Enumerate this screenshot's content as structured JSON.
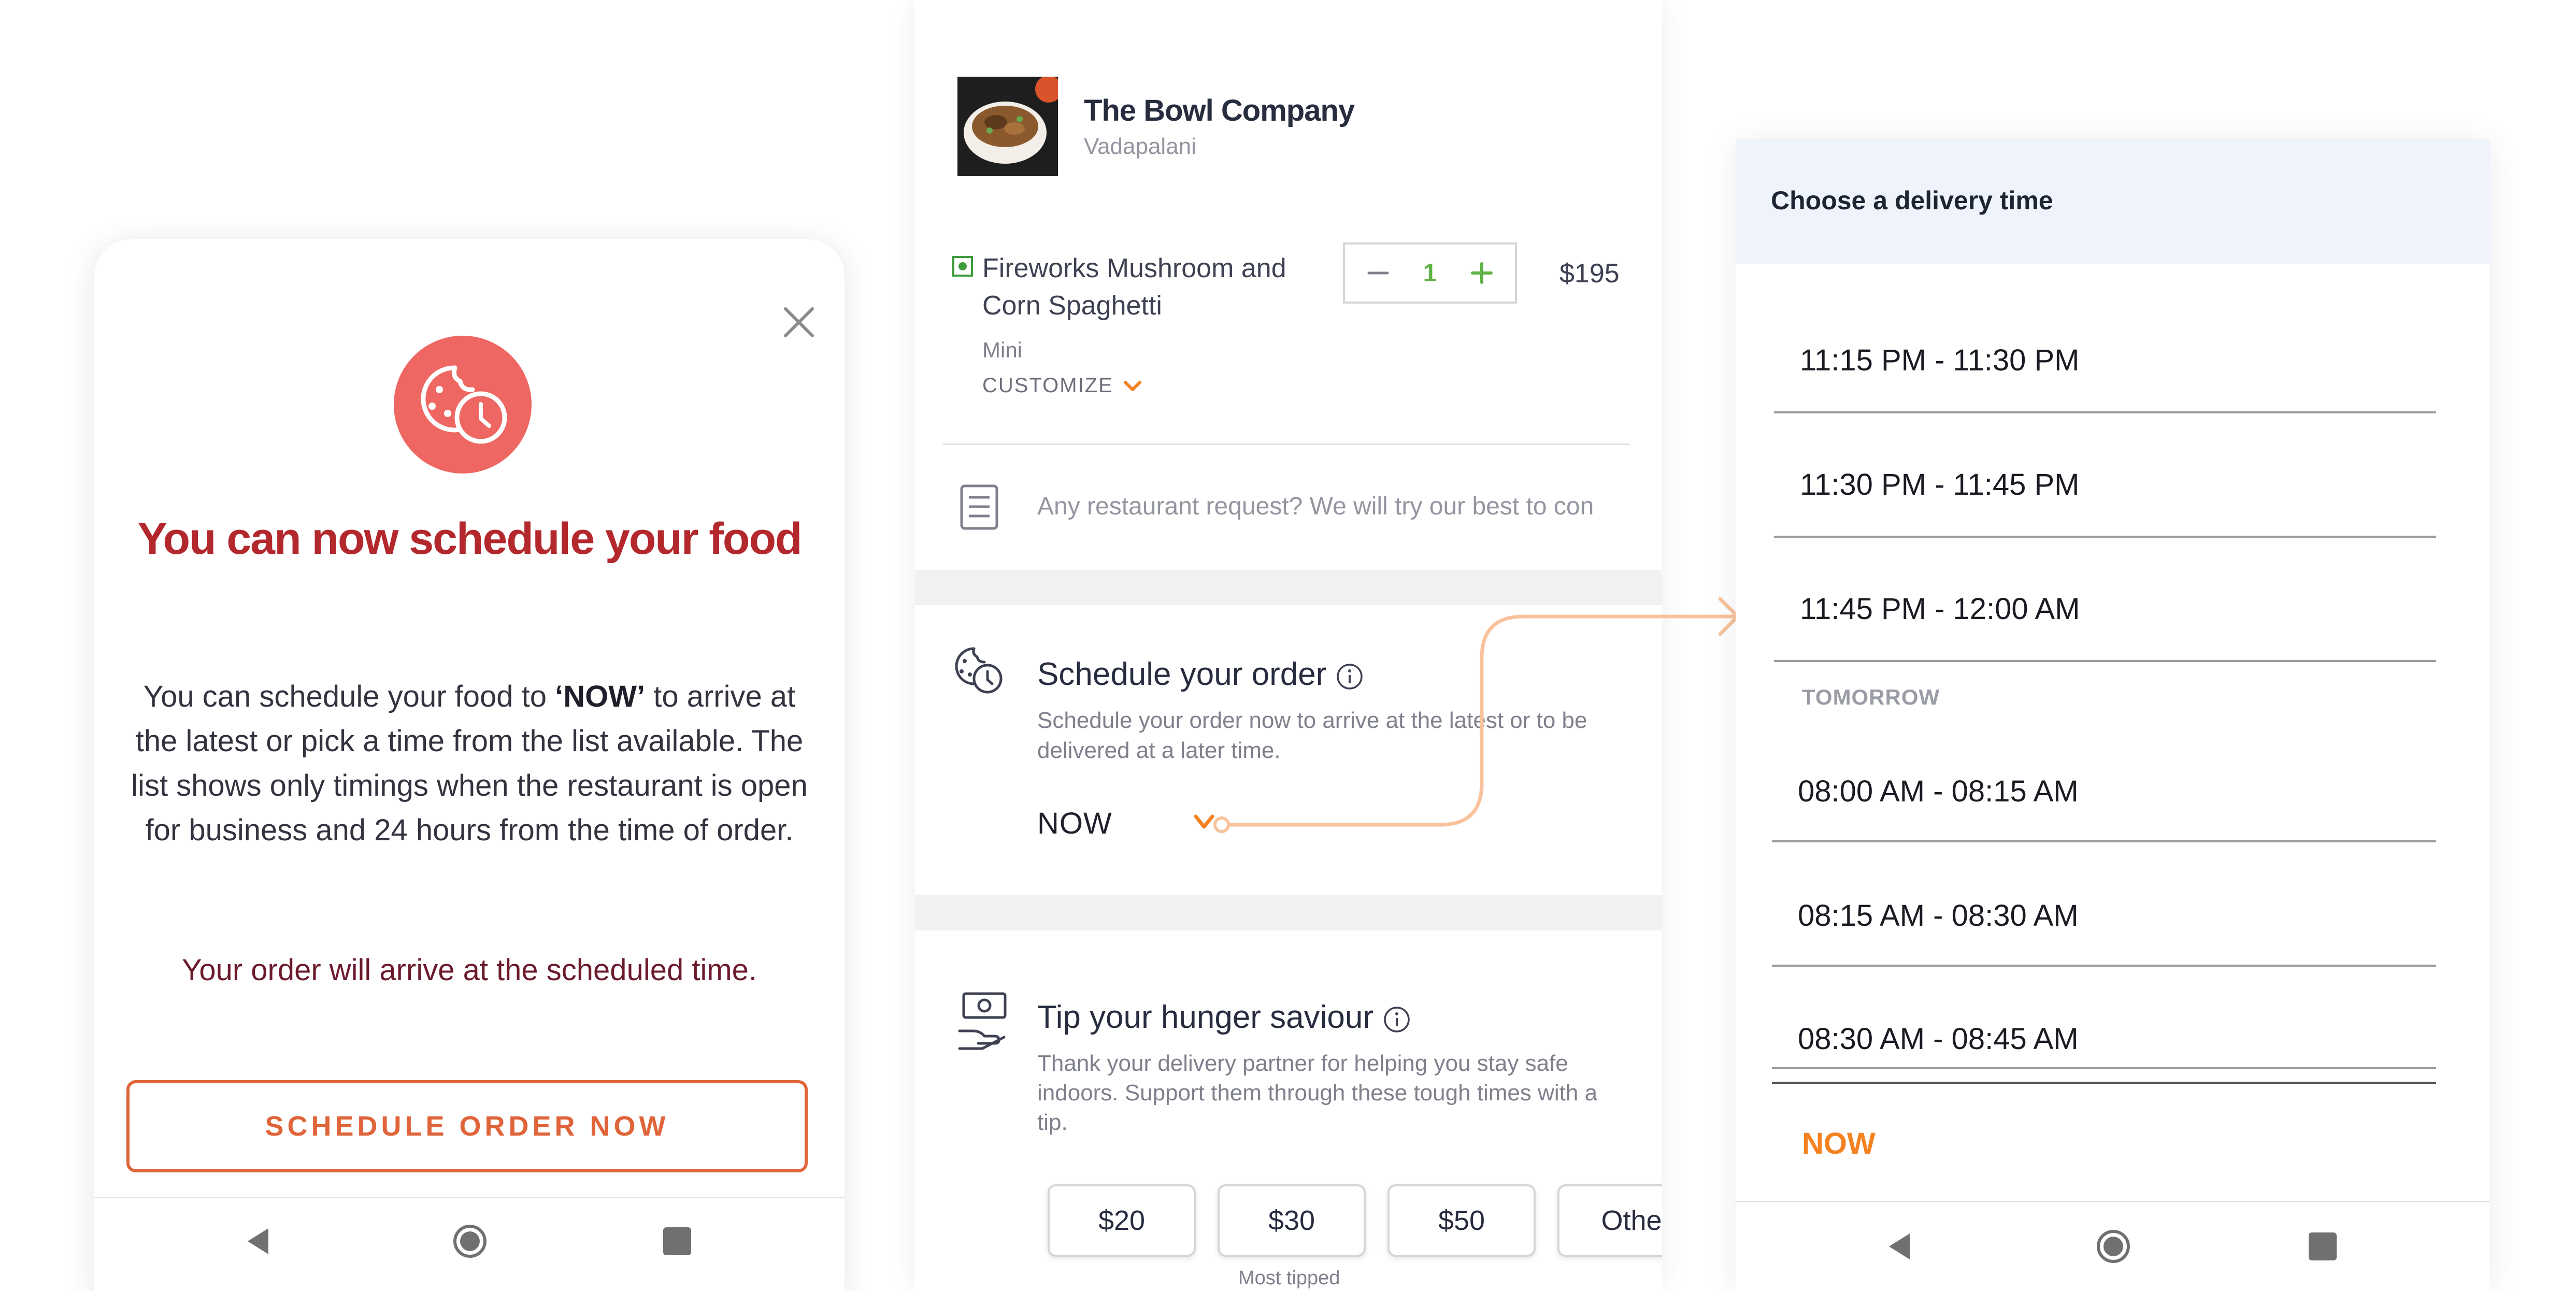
{
  "modal": {
    "title": "You can now schedule your food",
    "body_before": "You can schedule your food to ",
    "body_bold": "‘NOW’",
    "body_after": " to arrive at the latest or pick a time from the list available. The list shows only timings when the restaurant is open for business and 24 hours from the time of order.",
    "note": "Your order will arrive at the scheduled time.",
    "button_label": "SCHEDULE ORDER NOW",
    "icon": "cookie-clock-icon",
    "accent_color": "#ee6762",
    "title_color": "#b3282d"
  },
  "cart": {
    "restaurant": {
      "name": "The Bowl Company",
      "area": "Vadapalani"
    },
    "item": {
      "name": "Fireworks Mushroom and Corn Spaghetti",
      "variant": "Mini",
      "customize_label": "CUSTOMIZE",
      "quantity": "1",
      "price": "$195"
    },
    "request_placeholder": "Any restaurant request? We will try our best to con",
    "schedule": {
      "title": "Schedule your order",
      "description": "Schedule your order now to arrive at the latest or to be delivered at a later time.",
      "value": "NOW"
    },
    "tip": {
      "title": "Tip your hunger saviour",
      "description": "Thank your delivery partner for helping you stay safe indoors. Support them through these tough times with a tip.",
      "options": [
        "$20",
        "$30",
        "$50",
        "Othe"
      ],
      "caption": "Most tipped"
    }
  },
  "delivery": {
    "header": "Choose a delivery time",
    "today_slots": [
      "11:15 PM - 11:30 PM",
      "11:30 PM - 11:45 PM",
      "11:45 PM - 12:00 AM"
    ],
    "tomorrow_label": "TOMORROW",
    "tomorrow_slots": [
      "08:00 AM - 08:15 AM",
      "08:15 AM - 08:30 AM",
      "08:30 AM - 08:45 AM"
    ],
    "now_label": "NOW",
    "now_color": "#f58220"
  },
  "colors": {
    "brand_orange": "#e0643a",
    "veg_green": "#3d9b3d",
    "connector": "#f8c39c"
  }
}
